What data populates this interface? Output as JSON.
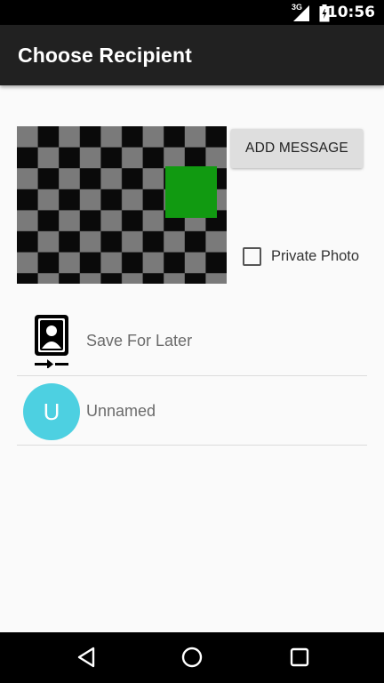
{
  "status_bar": {
    "time": "10:56",
    "network_type": "3G",
    "icons": [
      "signal-icon",
      "battery-icon"
    ]
  },
  "app_bar": {
    "title": "Choose Recipient"
  },
  "preview": {
    "description_icon": "checkerboard-image",
    "accent_color": "#119a11"
  },
  "actions": {
    "add_message_label": "ADD MESSAGE",
    "private_photo_label": "Private Photo",
    "private_photo_checked": false
  },
  "recipients": [
    {
      "label": "Save For Later",
      "icon": "save-for-later-icon"
    },
    {
      "label": "Unnamed",
      "avatar_letter": "U",
      "avatar_color": "#4dd0e1"
    }
  ],
  "nav_bar": {
    "icons": [
      "back-icon",
      "home-icon",
      "recents-icon"
    ]
  }
}
